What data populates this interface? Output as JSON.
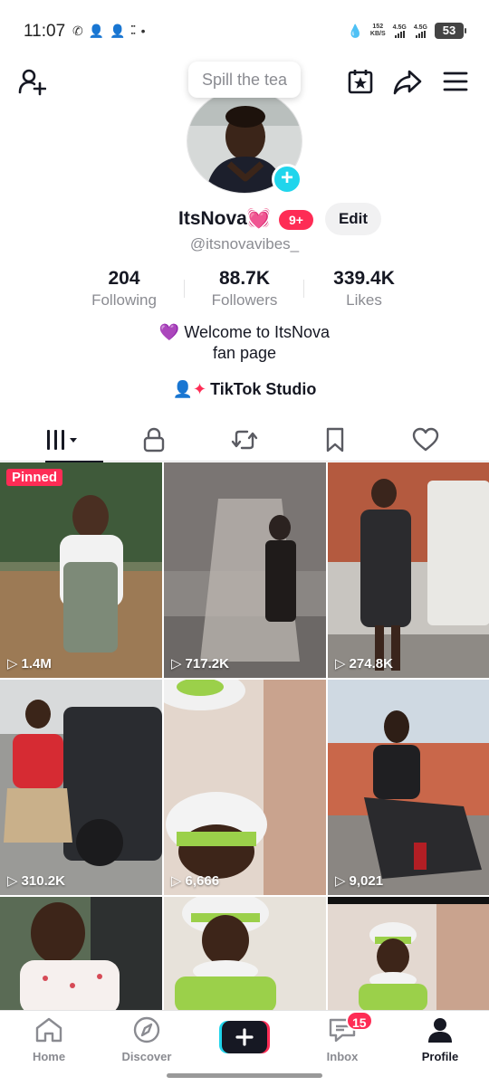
{
  "status_bar": {
    "time": "11:07",
    "net_speed_value": "152",
    "net_speed_unit": "KB/S",
    "sim1": "4.5G",
    "sim2": "4.5G",
    "battery": "53"
  },
  "bubble": {
    "text": "Spill the tea"
  },
  "profile": {
    "name": "ItsNova💓",
    "notif_badge": "9+",
    "edit_label": "Edit",
    "handle": "@itsnovavibes_",
    "stats": [
      {
        "value": "204",
        "label": "Following"
      },
      {
        "value": "88.7K",
        "label": "Followers"
      },
      {
        "value": "339.4K",
        "label": "Likes"
      }
    ],
    "bio_line1": "💜 Welcome to ItsNova",
    "bio_line2": "fan page",
    "studio_label": "TikTok Studio"
  },
  "tabs": [
    {
      "icon": "grid-videos-icon"
    },
    {
      "icon": "lock-icon"
    },
    {
      "icon": "repost-icon"
    },
    {
      "icon": "bookmark-icon"
    },
    {
      "icon": "heart-icon"
    }
  ],
  "videos": [
    {
      "views": "1.4M",
      "pinned_label": "Pinned"
    },
    {
      "views": "717.2K"
    },
    {
      "views": "274.8K"
    },
    {
      "views": "310.2K"
    },
    {
      "views": "6,666"
    },
    {
      "views": "9,021"
    },
    {
      "views": ""
    },
    {
      "views": ""
    },
    {
      "views": ""
    }
  ],
  "bottom_nav": {
    "home": "Home",
    "discover": "Discover",
    "inbox": "Inbox",
    "inbox_badge": "15",
    "profile": "Profile"
  },
  "colors": {
    "accent": "#fe2c55",
    "cyan": "#20d5ec",
    "text": "#161823",
    "muted": "#8a8b91"
  }
}
